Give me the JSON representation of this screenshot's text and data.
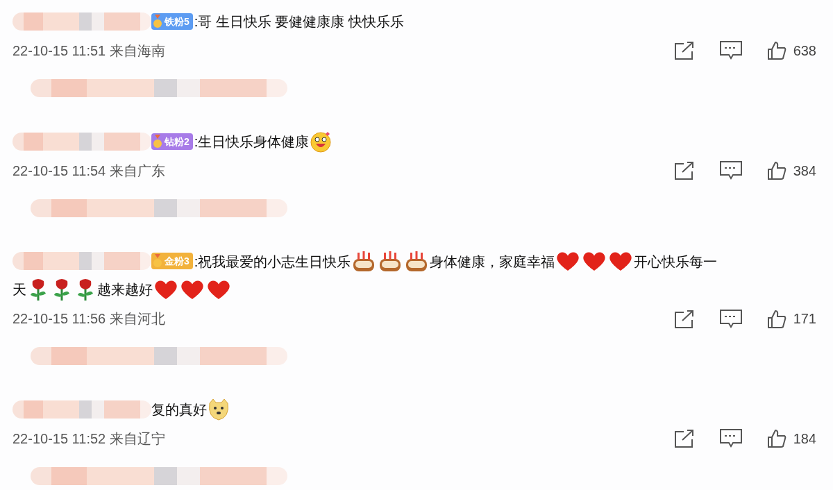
{
  "comments": [
    {
      "badge": {
        "label": "铁粉5",
        "color": "#5d9cf2"
      },
      "content": [
        {
          "kind": "text",
          "text": ":哥 生日快乐 要健健康康 快快乐乐"
        }
      ],
      "time": "22-10-15 11:51",
      "location": "来自海南",
      "likes": "638"
    },
    {
      "badge": {
        "label": "钻粉2",
        "color": "#a77be8"
      },
      "content": [
        {
          "kind": "text",
          "text": ":生日快乐身体健康"
        },
        {
          "kind": "face"
        }
      ],
      "time": "22-10-15 11:54",
      "location": "来自广东",
      "likes": "384"
    },
    {
      "badge": {
        "label": "金粉3",
        "color": "#f2b23c"
      },
      "content": [
        {
          "kind": "text",
          "text": ":祝我最爱的小志生日快乐"
        },
        {
          "kind": "cake"
        },
        {
          "kind": "cake"
        },
        {
          "kind": "cake"
        },
        {
          "kind": "text",
          "text": "身体健康，家庭幸福"
        },
        {
          "kind": "heart"
        },
        {
          "kind": "heart"
        },
        {
          "kind": "heart"
        },
        {
          "kind": "text",
          "text": "开心快乐每一"
        },
        {
          "kind": "break"
        },
        {
          "kind": "text",
          "text": "天"
        },
        {
          "kind": "rose"
        },
        {
          "kind": "rose"
        },
        {
          "kind": "rose"
        },
        {
          "kind": "text",
          "text": "越来越好"
        },
        {
          "kind": "heart"
        },
        {
          "kind": "heart"
        },
        {
          "kind": "heart"
        }
      ],
      "time": "22-10-15 11:56",
      "location": "来自河北",
      "likes": "171"
    },
    {
      "content": [
        {
          "kind": "text",
          "text": "复的真好"
        },
        {
          "kind": "dog"
        }
      ],
      "time": "22-10-15 11:52",
      "location": "来自辽宁",
      "likes": "184"
    }
  ]
}
